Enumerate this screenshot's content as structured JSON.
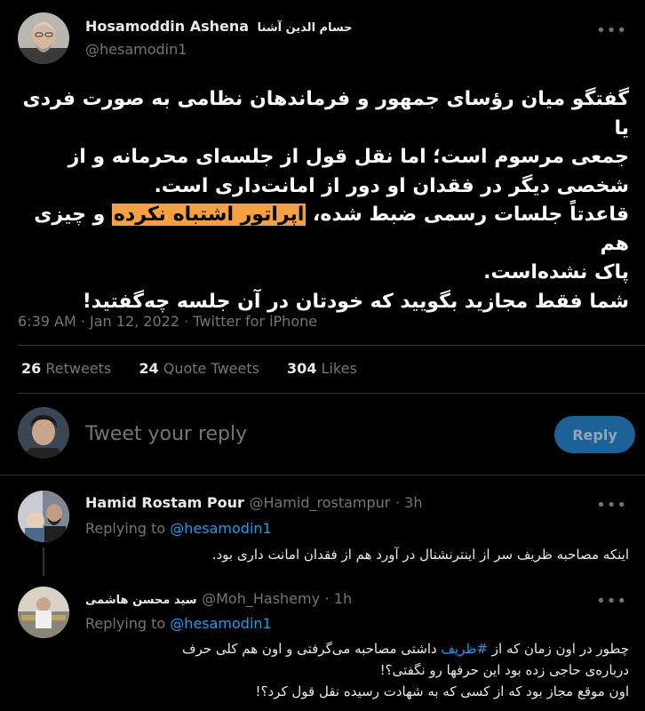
{
  "tweet": {
    "author_name": "Hosamoddin Ashena",
    "author_name_fa": "حسام الدین آشنا",
    "author_handle": "@hesamodin1",
    "body_lines": [
      "گفتگو میان رؤسای جمهور و فرماندهان نظامی به صورت فردی یا",
      "جمعی مرسوم است؛ اما نقل قول از جلسه‌ای محرمانه و از",
      "شخصی دیگر در فقدان او دور از امانت‌داری است."
    ],
    "body_line4_pre": "قاعدتاً جلسات رسمی ضبط شده، ",
    "body_highlight": "اپراتور اشتباه نکرده",
    "body_line4_post": " و چیزی هم",
    "body_line5": "پاک نشده‌است.",
    "body_line6": "شما فقط مجازید بگویید که خودتان در آن جلسه چه‌گفتید!",
    "meta": "6:39 AM · Jan 12, 2022 · Twitter for iPhone",
    "stats": {
      "retweets_num": "26",
      "retweets_label": "Retweets",
      "quotes_num": "24",
      "quotes_label": "Quote Tweets",
      "likes_num": "304",
      "likes_label": "Likes"
    }
  },
  "composer": {
    "placeholder": "Tweet your reply",
    "button_label": "Reply"
  },
  "replies": [
    {
      "name": "Hamid Rostam Pour",
      "handle": "@Hamid_rostampur",
      "time": "· 3h",
      "replying_prefix": "Replying to",
      "replying_to": "@hesamodin1",
      "text": "اینکه مصاحبه ظریف سر از اینترنشنال در آورد هم از فقدان امانت داری بود."
    },
    {
      "name": "سید محسن هاشمی",
      "handle": "@Moh_Hashemy",
      "time": "· 1h",
      "replying_prefix": "Replying to",
      "replying_to": "@hesamodin1",
      "text_l1_pre": "چطور در اون زمان که از ",
      "text_l1_tag": "#ظریف",
      "text_l1_post": " داشتی مصاحبه می‌گرفتی و اون هم کلی حرف",
      "text_l2": "درباره‌ی  حاجی زده بود این حرفها رو نگفتی؟!",
      "text_l3": "اون موقع مجاز بود که از کسی که به شهادت رسیده نقل قول کرد؟!"
    }
  ],
  "colors": {
    "background": "#000000",
    "accent": "#1d9bf0",
    "highlight": "#f5a041",
    "muted": "#71767b",
    "reply_button": "#1d6296"
  }
}
